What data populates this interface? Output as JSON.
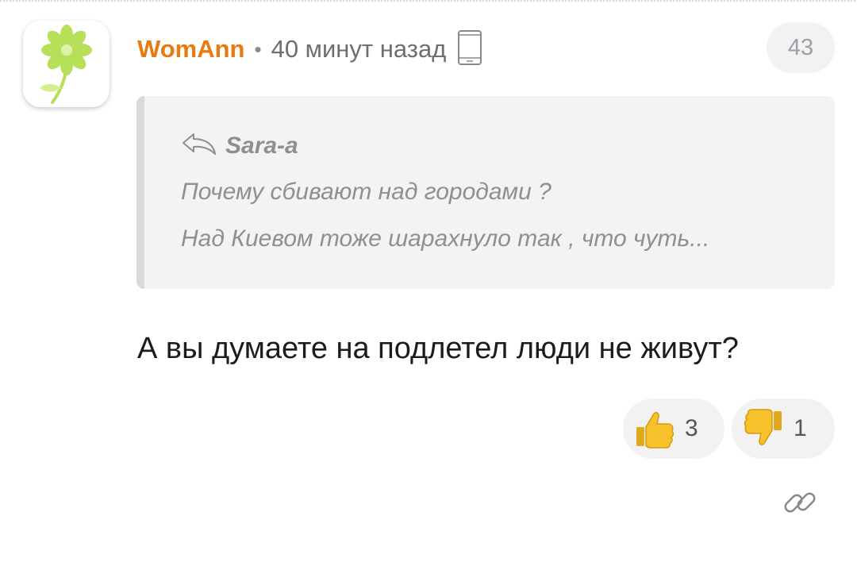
{
  "comment": {
    "author": "WomAnn",
    "separator": "•",
    "time": "40 минут назад",
    "counter": "43",
    "quote": {
      "author": "Sara-a",
      "line1": "Почему сбивают над городами ?",
      "line2": "Над Киевом тоже шарахнуло так , что чуть..."
    },
    "text": "А вы думаете на подлетел люди не живут?",
    "votes": {
      "up": "3",
      "down": "1"
    }
  },
  "icons": {
    "avatar": "green-flower-avatar",
    "device": "mobile-phone-icon",
    "reply": "reply-arrow-icon",
    "like": "thumbs-up-icon",
    "dislike": "thumbs-down-icon",
    "link": "link-icon"
  },
  "colors": {
    "author": "#ea7a10",
    "flower": "#b6e05a",
    "thumb": "#f7c12b",
    "vote_bg": "#f2f2f2",
    "quote_bg": "#f3f3f3"
  }
}
